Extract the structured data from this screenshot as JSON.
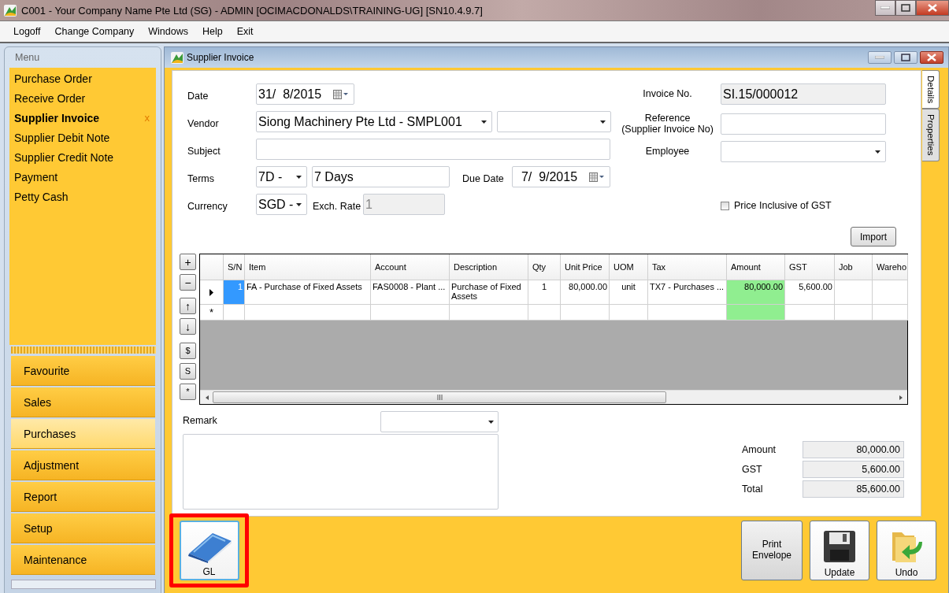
{
  "window": {
    "title": "C001 - Your Company Name Pte Ltd (SG) - ADMIN [OCIMACDONALDS\\TRAINING-UG] [SN10.4.9.7]"
  },
  "menu_bar": [
    "Logoff",
    "Change Company",
    "Windows",
    "Help",
    "Exit"
  ],
  "sidebar": {
    "header": "Menu",
    "items": [
      {
        "label": "Purchase Order",
        "selected": false
      },
      {
        "label": "Receive Order",
        "selected": false
      },
      {
        "label": "Supplier Invoice",
        "selected": true,
        "close_mark": "x"
      },
      {
        "label": "Supplier Debit Note",
        "selected": false
      },
      {
        "label": "Supplier Credit Note",
        "selected": false
      },
      {
        "label": "Payment",
        "selected": false
      },
      {
        "label": "Petty Cash",
        "selected": false
      }
    ],
    "modules": [
      {
        "label": "Favourite",
        "selected": false
      },
      {
        "label": "Sales",
        "selected": false
      },
      {
        "label": "Purchases",
        "selected": true
      },
      {
        "label": "Adjustment",
        "selected": false
      },
      {
        "label": "Report",
        "selected": false
      },
      {
        "label": "Setup",
        "selected": false
      },
      {
        "label": "Maintenance",
        "selected": false
      }
    ]
  },
  "document": {
    "title": "Supplier Invoice",
    "side_tabs": [
      {
        "label": "Details",
        "selected": true
      },
      {
        "label": "Properties",
        "selected": false
      }
    ],
    "form": {
      "date": {
        "label": "Date",
        "value": "31/  8/2015"
      },
      "vendor": {
        "label": "Vendor",
        "value": "Siong Machinery Pte Ltd - SMPL001"
      },
      "subject": {
        "label": "Subject"
      },
      "terms": {
        "label": "Terms",
        "code": "7D -",
        "value": "7 Days"
      },
      "due_date": {
        "label": "Due Date",
        "value": "7/  9/2015"
      },
      "currency": {
        "label": "Currency",
        "value": "SGD -"
      },
      "exch_rate": {
        "label": "Exch. Rate",
        "value": "1",
        "disabled": true
      },
      "invoice_no": {
        "label": "Invoice No.",
        "value": "SI.15/000012"
      },
      "reference": {
        "label": "Reference\n(Supplier Invoice No)"
      },
      "employee": {
        "label": "Employee"
      },
      "price_inclusive": {
        "label": "Price Inclusive of GST",
        "checked": false
      },
      "import_button": "Import"
    },
    "grid": {
      "side_buttons": [
        "+",
        "−",
        "↑",
        "↓",
        "$",
        "S",
        "*"
      ],
      "columns": [
        {
          "label": "S/N",
          "highlighted": false
        },
        {
          "label": "Item",
          "highlighted": false
        },
        {
          "label": "Account",
          "highlighted": false
        },
        {
          "label": "Description",
          "highlighted": false
        },
        {
          "label": "Qty",
          "highlighted": false
        },
        {
          "label": "Unit Price",
          "highlighted": false
        },
        {
          "label": "UOM",
          "highlighted": false
        },
        {
          "label": "Tax",
          "highlighted": false
        },
        {
          "label": "Amount",
          "highlighted": true
        },
        {
          "label": "GST",
          "highlighted": false
        },
        {
          "label": "Job",
          "highlighted": false
        },
        {
          "label": "Wareho",
          "highlighted": false
        }
      ],
      "rows": [
        {
          "current": true,
          "cells": [
            {
              "text": "1",
              "selected": true
            },
            {
              "text": "FA - Purchase of Fixed Assets",
              "selected": false
            },
            {
              "text": "FAS0008 - Plant ...",
              "selected": false
            },
            {
              "text": "Purchase of Fixed Assets",
              "selected": false
            },
            {
              "text": "1",
              "selected": false
            },
            {
              "text": "80,000.00",
              "selected": false
            },
            {
              "text": "unit",
              "selected": false
            },
            {
              "text": "TX7 - Purchases ...",
              "selected": false
            },
            {
              "text": "80,000.00",
              "selected": false
            },
            {
              "text": "5,600.00",
              "selected": false
            }
          ]
        }
      ],
      "new_row": {
        "marker": "*"
      }
    },
    "remark": {
      "label": "Remark"
    },
    "totals": [
      {
        "label": "Amount",
        "value": "80,000.00"
      },
      {
        "label": "GST",
        "value": "5,600.00"
      },
      {
        "label": "Total",
        "value": "85,600.00"
      }
    ]
  },
  "toolbar": {
    "left": [
      {
        "label": "GL",
        "kind": "gl",
        "highlighted": true
      }
    ],
    "right": [
      {
        "label": "Print Envelope",
        "kind": "text",
        "highlighted": false
      },
      {
        "label": "Update",
        "kind": "save",
        "highlighted": false
      },
      {
        "label": "Undo",
        "kind": "undo",
        "highlighted": false
      }
    ]
  }
}
